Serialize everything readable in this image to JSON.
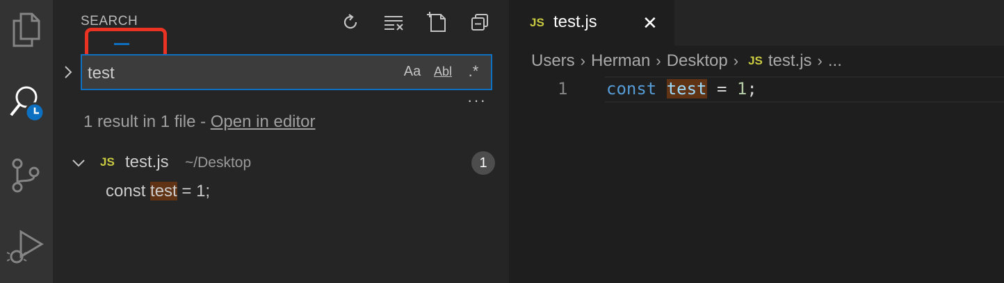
{
  "activity_bar": {
    "items": [
      {
        "icon": "files-icon"
      },
      {
        "icon": "search-history-icon",
        "active": true
      },
      {
        "icon": "source-control-icon"
      },
      {
        "icon": "run-debug-icon"
      }
    ]
  },
  "search_panel": {
    "title": "SEARCH",
    "actions": [
      "refresh-icon",
      "clear-results-icon",
      "new-search-editor-icon",
      "collapse-all-icon"
    ],
    "query": "test",
    "options": {
      "match_case": "Aa",
      "whole_word": "Abl",
      "regex": ".*"
    },
    "more": "···",
    "summary": "1 result in 1 file - ",
    "open_in_editor": "Open in editor",
    "file": {
      "badge": "JS",
      "name": "test.js",
      "path": "~/Desktop",
      "count": "1"
    },
    "match": {
      "before": "const ",
      "highlight": "test",
      "after": " = 1;"
    }
  },
  "editor": {
    "tab": {
      "badge": "JS",
      "name": "test.js",
      "close": "✕"
    },
    "breadcrumb": [
      "Users",
      "Herman",
      "Desktop"
    ],
    "breadcrumb_file": {
      "badge": "JS",
      "name": "test.js"
    },
    "breadcrumb_more": "...",
    "line_number": "1",
    "code": {
      "keyword": "const",
      "variable": "test",
      "operator": " = ",
      "number": "1",
      "end": ";"
    }
  },
  "colors": {
    "accent": "#0e70c0",
    "annotation": "#ea3323",
    "highlight": "#613315",
    "js_badge": "#cbcb41"
  }
}
